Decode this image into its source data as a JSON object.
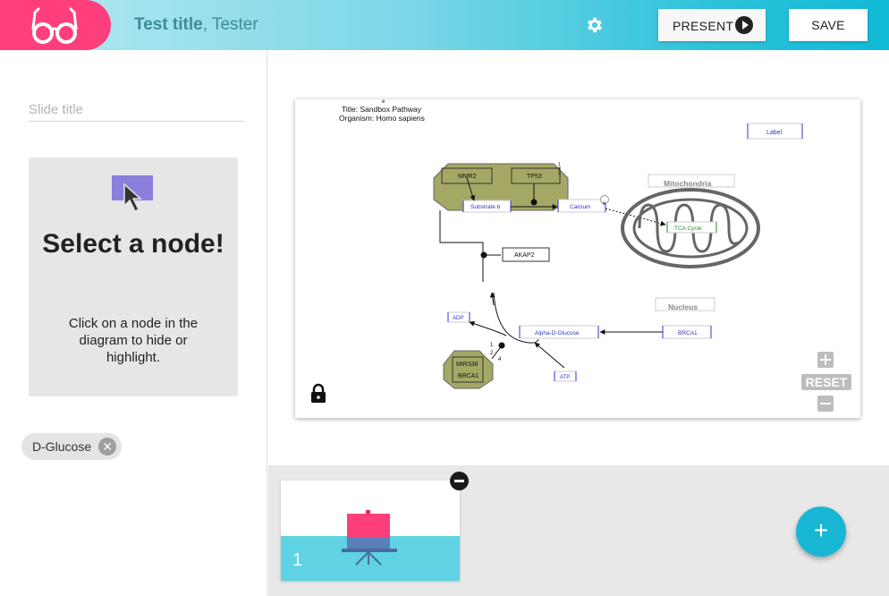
{
  "header": {
    "title": "Test title",
    "separator": ", ",
    "author": "Tester",
    "present_label": "PRESENT",
    "save_label": "SAVE",
    "icons": {
      "logo": "glasses-icon",
      "settings": "gear-icon",
      "present": "play-icon"
    },
    "colors": {
      "logo_bg": "#ff3f7c",
      "accent": "#10b9d6"
    }
  },
  "sidebar": {
    "slide_title_placeholder": "Slide title",
    "select_card": {
      "heading": "Select a node!",
      "description": "Click on a node in the diagram to hide or highlight."
    },
    "chips": [
      {
        "label": "D-Glucose"
      }
    ]
  },
  "diagram": {
    "title": "Title: Sandbox Pathway",
    "organism": "Organism: Homo sapiens",
    "nodes": {
      "label": "Label",
      "mitochondria": "Mitochondria",
      "tca": "TCA Cycle",
      "mmr2": "MMR2",
      "tp53": "TP53",
      "substrate": "Substrate b",
      "calcium": "Calcium",
      "akap2": "AKAP2",
      "nucleus": "Nucleus",
      "adp": "ADP",
      "alpha_glucose": "Alpha-D-Glucose",
      "brca1_right": "BRCA1",
      "mir338": "MIR338",
      "brca1_group": "BRCA1",
      "atp": "ATP"
    },
    "small_marks": {
      "e1": "e",
      "e2": "e",
      "n1": "1",
      "n2": "2",
      "n3": "3",
      "n4": "4"
    },
    "controls": {
      "reset_label": "RESET"
    }
  },
  "slides": [
    {
      "number": "1"
    }
  ],
  "fab_label": "+"
}
